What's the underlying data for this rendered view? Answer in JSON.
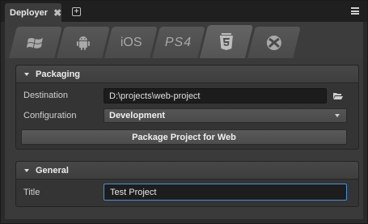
{
  "window": {
    "tab_label": "Deployer",
    "close_glyph": "✖",
    "add_glyph": "+"
  },
  "platforms": [
    {
      "name": "windows-icon"
    },
    {
      "name": "android-icon"
    },
    {
      "name": "ios-label",
      "label": "iOS"
    },
    {
      "name": "ps4-label",
      "label": "PS4"
    },
    {
      "name": "html5-icon",
      "active": true
    },
    {
      "name": "xbox-icon"
    }
  ],
  "packaging": {
    "title": "Packaging",
    "destination_label": "Destination",
    "destination_value": "D:\\projects\\web-project",
    "configuration_label": "Configuration",
    "configuration_value": "Development",
    "package_button": "Package Project for Web"
  },
  "general": {
    "title": "General",
    "title_label": "Title",
    "title_value": "Test Project"
  },
  "colors": {
    "background": "#2b2b2b",
    "panel": "#3a3a3a",
    "focus_border": "#4a90d9"
  }
}
